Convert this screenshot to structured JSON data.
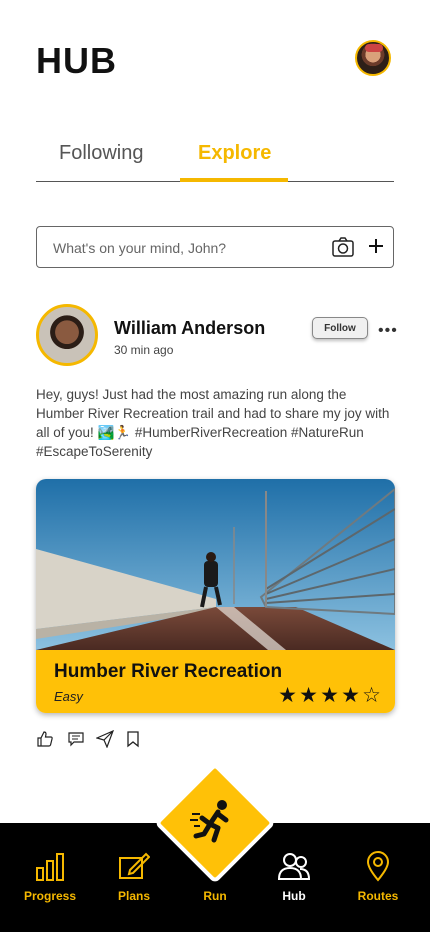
{
  "header": {
    "title": "HUB"
  },
  "tabs": [
    {
      "label": "Following"
    },
    {
      "label": "Explore",
      "active": true
    }
  ],
  "composer": {
    "placeholder": "What's on your mind, John?"
  },
  "post": {
    "author": "William Anderson",
    "time": "30 min ago",
    "follow_label": "Follow",
    "text": "Hey, guys! Just had the most amazing run along the Humber River Recreation trail and had to share my joy with all of you! 🏞️🏃 #HumberRiverRecreation #NatureRun #EscapeToSerenity",
    "route": {
      "name": "Humber River Recreation",
      "difficulty": "Easy",
      "rating": 4,
      "rating_max": 5
    }
  },
  "nav": {
    "items": [
      {
        "label": "Progress",
        "icon": "bar-chart-icon"
      },
      {
        "label": "Plans",
        "icon": "edit-icon"
      },
      {
        "label": "Run",
        "icon": "runner-icon"
      },
      {
        "label": "Hub",
        "icon": "users-icon",
        "active": true
      },
      {
        "label": "Routes",
        "icon": "map-pin-icon"
      }
    ]
  },
  "colors": {
    "accent": "#ffc107",
    "nav_bg": "#000000",
    "tab_active": "#f5b800"
  }
}
